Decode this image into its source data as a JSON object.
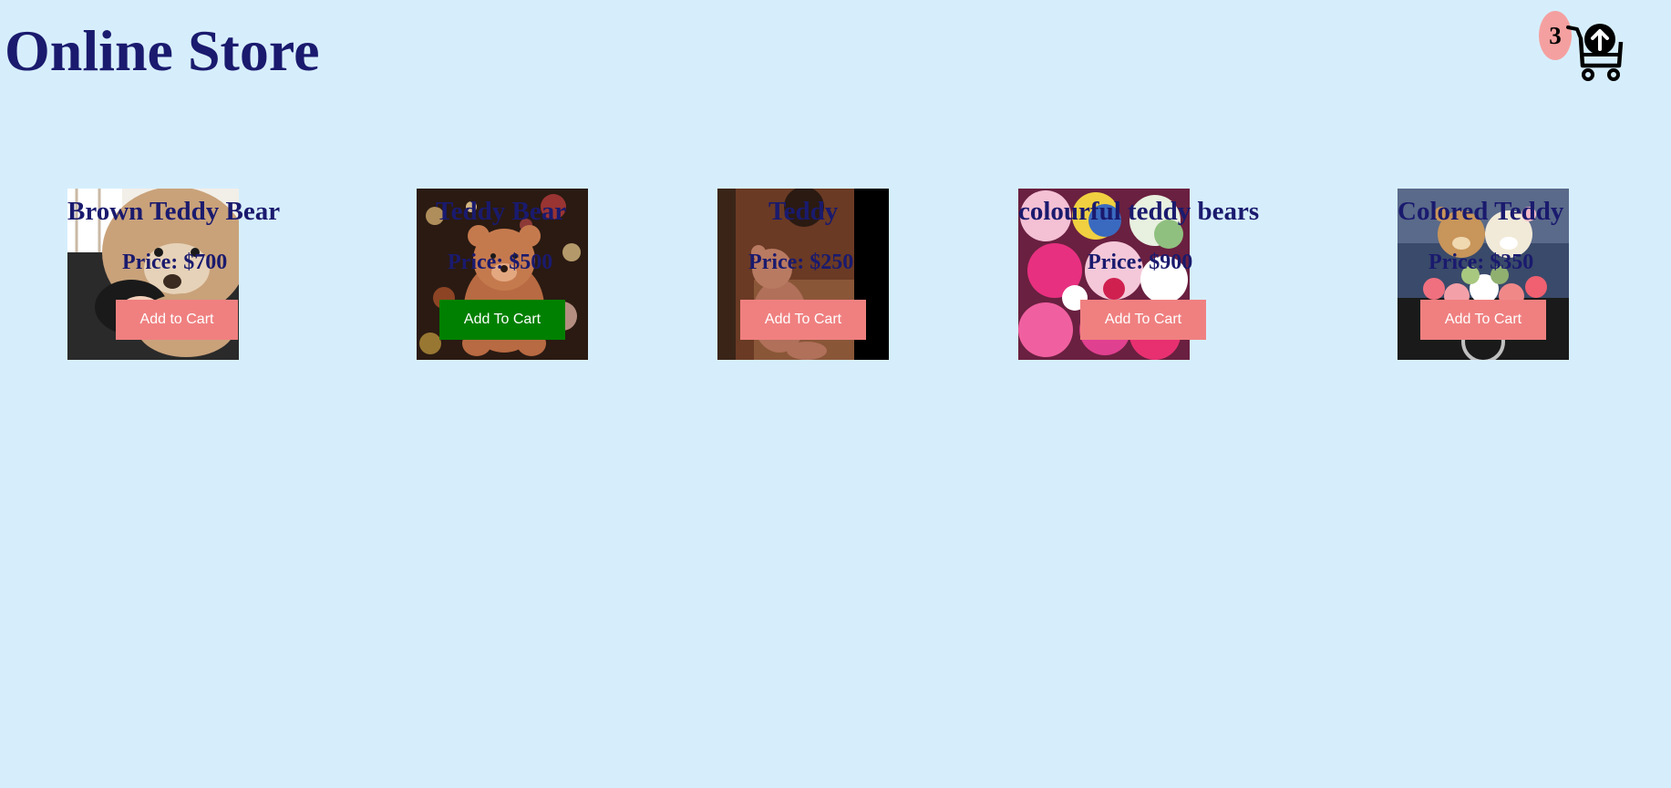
{
  "header": {
    "title": "Online Store"
  },
  "cart": {
    "count": "3",
    "icon": "cart-upload-icon"
  },
  "products": [
    {
      "name": "Brown Teddy Bear",
      "price": "Price: $700",
      "button_label": "Add to Cart",
      "button_color": "#f08080",
      "image": "woman-hugging-giant-teddy-bear"
    },
    {
      "name": "Teddy Bear",
      "price": "Price: $500",
      "button_label": "Add To Cart",
      "button_color": "#008000",
      "image": "teddy-bear-with-bokeh-lights"
    },
    {
      "name": "Teddy",
      "price": "Price: $250",
      "button_label": "Add To Cart",
      "button_color": "#f08080",
      "image": "teddy-bear-in-dark-room"
    },
    {
      "name": "colourful teddy bears",
      "price": "Price: $900",
      "button_label": "Add To Cart",
      "button_color": "#f08080",
      "image": "pile-of-colourful-plush-toys"
    },
    {
      "name": "Colored Teddy",
      "price": "Price: $350",
      "button_label": "Add To Cart",
      "button_color": "#f08080",
      "image": "two-teddy-bears-with-flowers-on-car"
    }
  ],
  "colors": {
    "background": "#d6eefc",
    "text": "#1a1a6e",
    "badge": "#f5a0a0"
  }
}
